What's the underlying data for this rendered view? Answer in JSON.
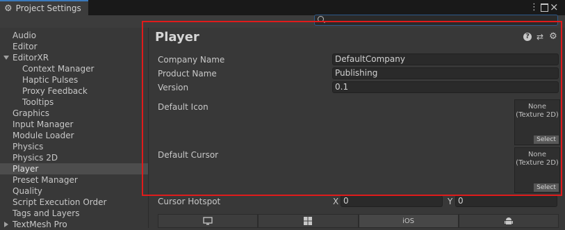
{
  "window": {
    "tab_title": "Project Settings",
    "tab_icon": "gear-icon"
  },
  "search": {
    "placeholder": ""
  },
  "sidebar": {
    "items": [
      {
        "label": "Audio"
      },
      {
        "label": "Editor"
      },
      {
        "label": "EditorXR"
      },
      {
        "label": "Context Manager"
      },
      {
        "label": "Haptic Pulses"
      },
      {
        "label": "Proxy Feedback"
      },
      {
        "label": "Tooltips"
      },
      {
        "label": "Graphics"
      },
      {
        "label": "Input Manager"
      },
      {
        "label": "Module Loader"
      },
      {
        "label": "Physics"
      },
      {
        "label": "Physics 2D"
      },
      {
        "label": "Player"
      },
      {
        "label": "Preset Manager"
      },
      {
        "label": "Quality"
      },
      {
        "label": "Script Execution Order"
      },
      {
        "label": "Tags and Layers"
      },
      {
        "label": "TextMesh Pro"
      }
    ],
    "selected": "Player"
  },
  "page": {
    "title": "Player",
    "header_icons": [
      "help-icon",
      "presets-icon",
      "settings-icon"
    ]
  },
  "fields": {
    "company_name": {
      "label": "Company Name",
      "value": "DefaultCompany"
    },
    "product_name": {
      "label": "Product Name",
      "value": "Publishing"
    },
    "version": {
      "label": "Version",
      "value": "0.1"
    }
  },
  "default_icon": {
    "label": "Default Icon",
    "slot_line1": "None",
    "slot_line2": "(Texture 2D)",
    "select_label": "Select"
  },
  "default_cursor": {
    "label": "Default Cursor",
    "slot_line1": "None",
    "slot_line2": "(Texture 2D)",
    "select_label": "Select"
  },
  "cursor_hotspot": {
    "label": "Cursor Hotspot",
    "x_label": "X",
    "x_value": "0",
    "y_label": "Y",
    "y_value": "0"
  },
  "platform_tabs": [
    {
      "icon": "monitor-icon",
      "label": ""
    },
    {
      "icon": "windows-icon",
      "label": ""
    },
    {
      "icon": "",
      "label": "iOS"
    },
    {
      "icon": "android-icon",
      "label": ""
    }
  ],
  "colors": {
    "highlight": "#e01b1b",
    "accent": "#3a79bb",
    "background": "#383838"
  }
}
